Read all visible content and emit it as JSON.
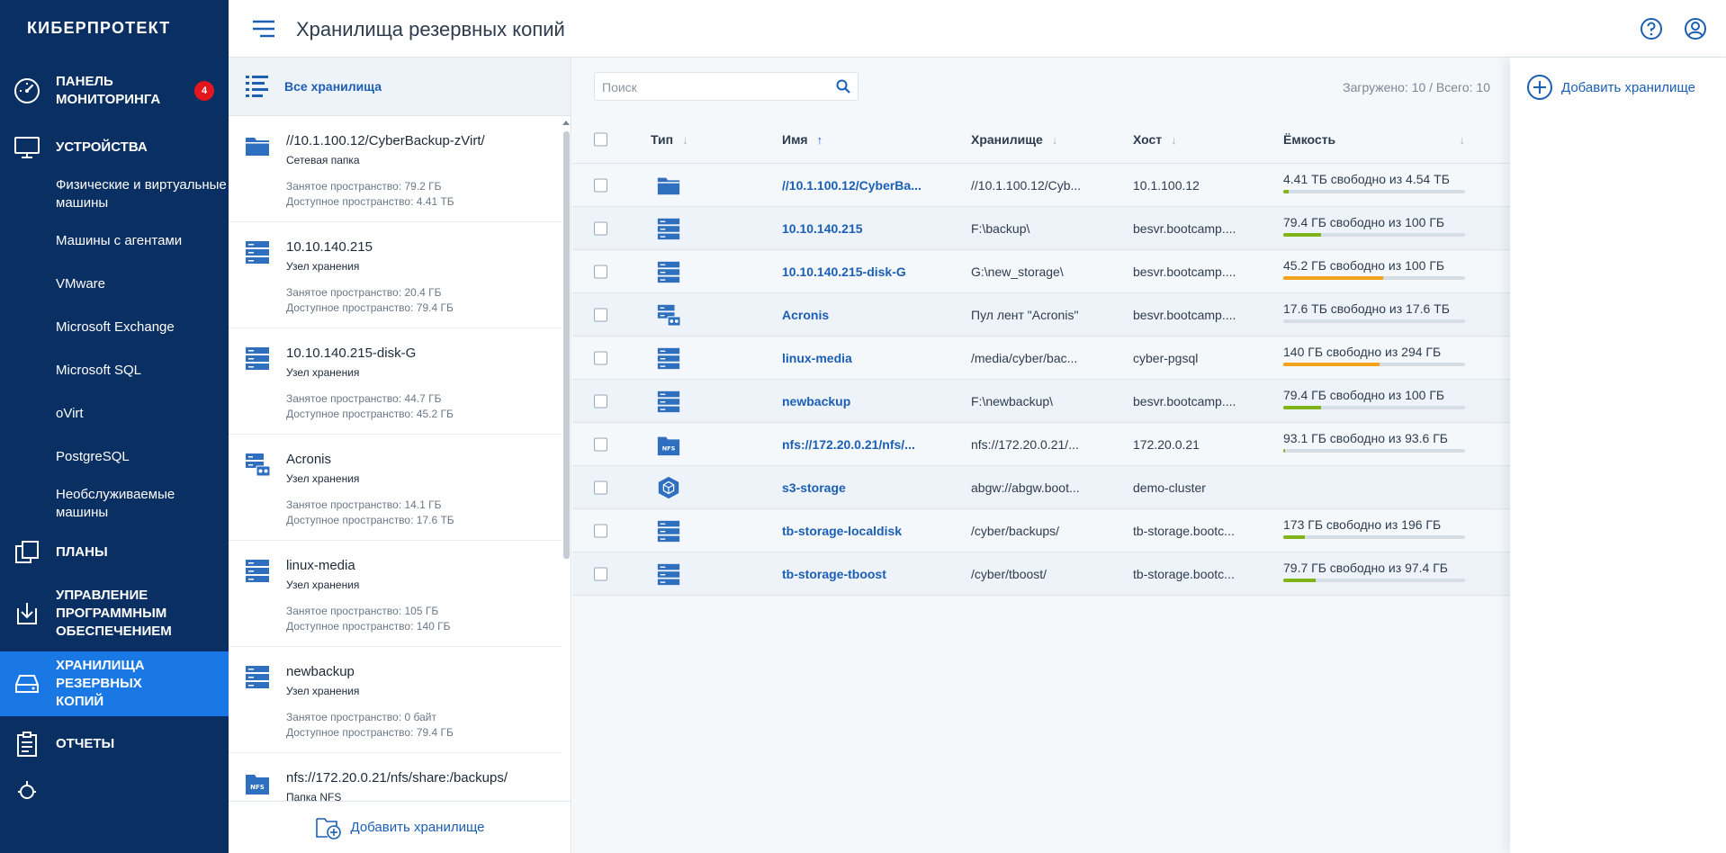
{
  "app": {
    "brand": "КИБЕРПРОТЕКТ",
    "title": "Хранилища резервных копий"
  },
  "sidebar": {
    "monitoring": {
      "label": "ПАНЕЛЬ МОНИТОРИНГА",
      "badge": "4"
    },
    "devices": {
      "label": "УСТРОЙСТВА"
    },
    "device_items": [
      "Физические и виртуальные машины",
      "Машины с агентами",
      "VMware",
      "Microsoft Exchange",
      "Microsoft SQL",
      "oVirt",
      "PostgreSQL",
      "Необслуживаемые машины"
    ],
    "plans": {
      "label": "ПЛАНЫ"
    },
    "software": {
      "label": "УПРАВЛЕНИЕ ПРОГРАММНЫМ ОБЕСПЕЧЕНИЕМ"
    },
    "storages": {
      "label": "ХРАНИЛИЩА РЕЗЕРВНЫХ КОПИЙ"
    },
    "reports": {
      "label": "ОТЧЕТЫ"
    }
  },
  "list": {
    "header": "Все хранилища",
    "add_label": "Добавить хранилище",
    "items": [
      {
        "name": "//10.1.100.12/CyberBackup-zVirt/",
        "type": "Сетевая папка",
        "used": "Занятое пространство: 79.2 ГБ",
        "free": "Доступное пространство: 4.41 ТБ",
        "icon": "folder"
      },
      {
        "name": "10.10.140.215",
        "type": "Узел хранения",
        "used": "Занятое пространство: 20.4 ГБ",
        "free": "Доступное пространство: 79.4 ГБ",
        "icon": "server"
      },
      {
        "name": "10.10.140.215-disk-G",
        "type": "Узел хранения",
        "used": "Занятое пространство: 44.7 ГБ",
        "free": "Доступное пространство: 45.2 ГБ",
        "icon": "server"
      },
      {
        "name": "Acronis",
        "type": "Узел хранения",
        "used": "Занятое пространство: 14.1 ГБ",
        "free": "Доступное пространство: 17.6 ТБ",
        "icon": "tape"
      },
      {
        "name": "linux-media",
        "type": "Узел хранения",
        "used": "Занятое пространство: 105 ГБ",
        "free": "Доступное пространство: 140 ГБ",
        "icon": "server"
      },
      {
        "name": "newbackup",
        "type": "Узел хранения",
        "used": "Занятое пространство: 0 байт",
        "free": "Доступное пространство: 79.4 ГБ",
        "icon": "server"
      },
      {
        "name": "nfs://172.20.0.21/nfs/share:/backups/",
        "type": "Папка NFS",
        "used": "",
        "free": "",
        "icon": "nfs"
      }
    ]
  },
  "main": {
    "search_placeholder": "Поиск",
    "loaded": "Загружено: 10 / Всего: 10",
    "columns": {
      "type": "Тип",
      "name": "Имя",
      "storage": "Хранилище",
      "host": "Хост",
      "capacity": "Ёмкость"
    },
    "rows": [
      {
        "icon": "folder",
        "name": "//10.1.100.12/CyberBa...",
        "storage": "//10.1.100.12/Cyb...",
        "host": "10.1.100.12",
        "capacity": "4.41 ТБ свободно из 4.54 ТБ",
        "used_fraction": 0.03,
        "bar_color": "#7fb51b"
      },
      {
        "icon": "server",
        "name": "10.10.140.215",
        "storage": "F:\\backup\\",
        "host": "besvr.bootcamp....",
        "capacity": "79.4 ГБ свободно из 100 ГБ",
        "used_fraction": 0.21,
        "bar_color": "#7fb51b"
      },
      {
        "icon": "server",
        "name": "10.10.140.215-disk-G",
        "storage": "G:\\new_storage\\",
        "host": "besvr.bootcamp....",
        "capacity": "45.2 ГБ свободно из 100 ГБ",
        "used_fraction": 0.55,
        "bar_color": "#f2a31b"
      },
      {
        "icon": "tape",
        "name": "Acronis",
        "storage": "Пул лент \"Acronis\"",
        "host": "besvr.bootcamp....",
        "capacity": "17.6 ТБ свободно из 17.6 ТБ",
        "used_fraction": 0.0,
        "bar_color": "#7fb51b"
      },
      {
        "icon": "server",
        "name": "linux-media",
        "storage": "/media/cyber/bac...",
        "host": "cyber-pgsql",
        "capacity": "140 ГБ свободно из 294 ГБ",
        "used_fraction": 0.53,
        "bar_color": "#f2a31b"
      },
      {
        "icon": "server",
        "name": "newbackup",
        "storage": "F:\\newbackup\\",
        "host": "besvr.bootcamp....",
        "capacity": "79.4 ГБ свободно из 100 ГБ",
        "used_fraction": 0.21,
        "bar_color": "#7fb51b"
      },
      {
        "icon": "nfs",
        "name": "nfs://172.20.0.21/nfs/...",
        "storage": "nfs://172.20.0.21/...",
        "host": "172.20.0.21",
        "capacity": "93.1 ГБ свободно из 93.6 ГБ",
        "used_fraction": 0.01,
        "bar_color": "#7fb51b"
      },
      {
        "icon": "cube",
        "name": "s3-storage",
        "storage": "abgw://abgw.boot...",
        "host": "demo-cluster",
        "capacity": "",
        "used_fraction": null,
        "bar_color": ""
      },
      {
        "icon": "server",
        "name": "tb-storage-localdisk",
        "storage": "/cyber/backups/",
        "host": "tb-storage.bootc...",
        "capacity": "173 ГБ свободно из 196 ГБ",
        "used_fraction": 0.12,
        "bar_color": "#7fb51b"
      },
      {
        "icon": "server",
        "name": "tb-storage-tboost",
        "storage": "/cyber/tboost/",
        "host": "tb-storage.bootc...",
        "capacity": "79.7 ГБ свободно из 97.4 ГБ",
        "used_fraction": 0.18,
        "bar_color": "#7fb51b"
      }
    ]
  },
  "right_panel": {
    "add_label": "Добавить хранилище"
  },
  "colors": {
    "sidebar_bg": "#0a2f62",
    "active_bg": "#1a78e5",
    "link": "#1b5fb5",
    "badge": "#e3161e",
    "bar_ok": "#7fb51b",
    "bar_warn": "#f2a31b"
  }
}
